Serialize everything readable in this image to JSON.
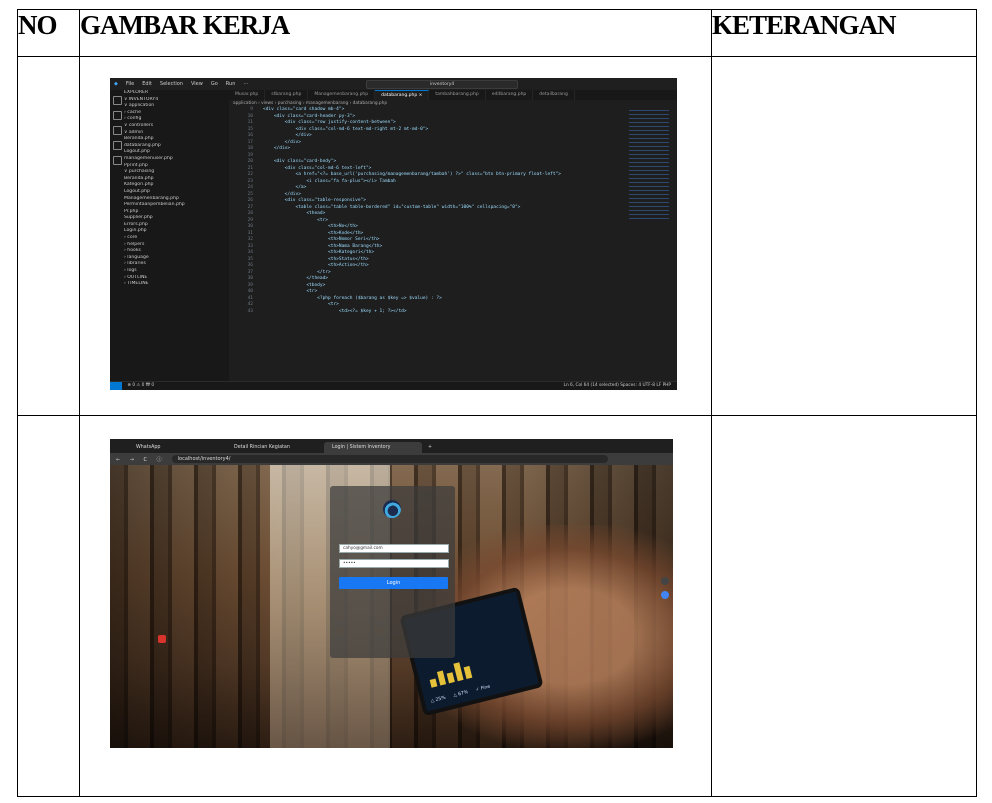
{
  "table": {
    "headers": {
      "no": "NO",
      "gambar": "GAMBAR KERJA",
      "keterangan": "KETERANGAN"
    }
  },
  "vscode": {
    "menu": [
      "File",
      "Edit",
      "Selection",
      "View",
      "Go",
      "Run",
      "···"
    ],
    "search": "inventory4",
    "explorer": [
      "EXPLORER",
      "∨ INVENTORY4",
      "  ∨ application",
      "    › cache",
      "    › config",
      "    ∨ controllers",
      "      ∨ admin",
      "        Beranda.php",
      "        databarang.php",
      "        Logout.php",
      "        managemenuser.php",
      "        Pprint.php",
      "      ∨ purchasing",
      "        Beranda.php",
      "        Kategori.php",
      "        Logout.php",
      "        Managemenbarang.php",
      "        Permintaanpembelian.php",
      "        Pr.php",
      "        Supplier.php",
      "      Errors.php",
      "      Login.php",
      "    › core",
      "    › helpers",
      "    › hooks",
      "    › language",
      "    › libraries",
      "    › logs",
      "› OUTLINE",
      "› TIMELINE"
    ],
    "tabs": [
      "Musar.php",
      "stbarang.php",
      "Managemenbarang.php",
      "databarang.php ×",
      "tambahbarang.php",
      "editbarang.php",
      "detailbarang"
    ],
    "breadcrumb": "application › views › purchasing › managemenbarang › databarang.php",
    "code": [
      {
        "n": "9",
        "t": "<div class=\"card shadow mb-4\">"
      },
      {
        "n": "10",
        "t": "    <div class=\"card-header py-3\">"
      },
      {
        "n": "11",
        "t": "        <div class=\"row justify-content-between\">"
      },
      {
        "n": "15",
        "t": "            <div class=\"col-md-6 text-md-right mt-2 mt-md-0\">"
      },
      {
        "n": "16",
        "t": "            </div>"
      },
      {
        "n": "17",
        "t": "        </div>"
      },
      {
        "n": "18",
        "t": "    </div>"
      },
      {
        "n": "19",
        "t": ""
      },
      {
        "n": "20",
        "t": "    <div class=\"card-body\">"
      },
      {
        "n": "21",
        "t": "        <div class=\"col-md-6 text-left\">"
      },
      {
        "n": "22",
        "t": "            <a href=\"<?= base_url('purchasing/managemenbarang/tambah') ?>\" class=\"btn btn-primary float-left\">"
      },
      {
        "n": "23",
        "t": "                <i class=\"fa fa-plus\"></i> Tambah"
      },
      {
        "n": "24",
        "t": "            </a>"
      },
      {
        "n": "25",
        "t": "        </div>"
      },
      {
        "n": "26",
        "t": "        <div class=\"table-responsive\">"
      },
      {
        "n": "27",
        "t": "            <table class=\"table table-bordered\" id=\"custom-table\" width=\"100%\" cellspacing=\"0\">"
      },
      {
        "n": "28",
        "t": "                <thead>"
      },
      {
        "n": "29",
        "t": "                    <tr>"
      },
      {
        "n": "30",
        "t": "                        <th>No</th>"
      },
      {
        "n": "31",
        "t": "                        <th>Kode</th>"
      },
      {
        "n": "32",
        "t": "                        <th>Nomor Seri</th>"
      },
      {
        "n": "33",
        "t": "                        <th>Nama Barang</th>"
      },
      {
        "n": "34",
        "t": "                        <th>Kategori</th>"
      },
      {
        "n": "35",
        "t": "                        <th>Status</th>"
      },
      {
        "n": "36",
        "t": "                        <th>Action</th>"
      },
      {
        "n": "37",
        "t": "                    </tr>"
      },
      {
        "n": "38",
        "t": "                </thead>"
      },
      {
        "n": "39",
        "t": "                <tbody>"
      },
      {
        "n": "40",
        "t": "                <tr>"
      },
      {
        "n": "41",
        "t": "                    <?php foreach ($barang as $key => $value) : ?>"
      },
      {
        "n": "42",
        "t": "                        <tr>"
      },
      {
        "n": "43",
        "t": "                            <td><?= $key + 1; ?></td>"
      }
    ],
    "status_left": "⊗ 0 ⚠ 0   ₩ 0",
    "status_right": "Ln 6, Col 64 (14 selected)   Spaces: 4   UTF-8   LF   PHP"
  },
  "browser": {
    "tabs": [
      "WhatsApp",
      "Detail Rincian Kegiatan",
      "Login | Sistem Inventory"
    ],
    "new_tab": "+",
    "url": "localhost/inventory4/",
    "nav": "← → C ⓘ",
    "login": {
      "email": "cahyo@gmail.com",
      "password": "•••••",
      "button": "Login"
    },
    "tablet_stats": [
      "△ 25%",
      "△ 67%",
      "✓ Fine"
    ]
  }
}
